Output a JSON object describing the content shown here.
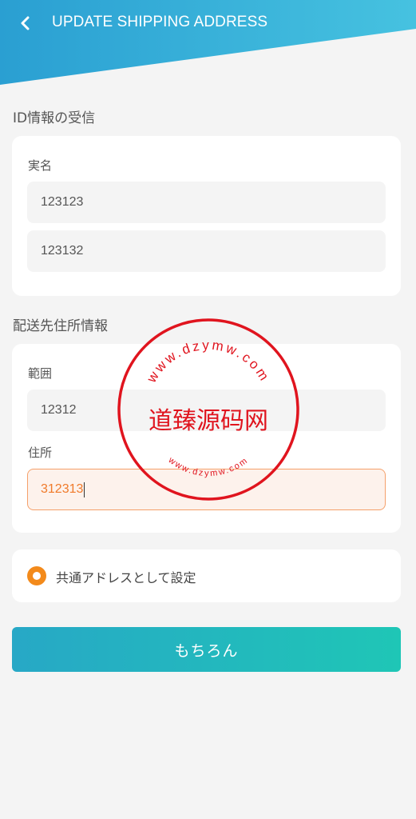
{
  "header": {
    "title": "UPDATE SHIPPING ADDRESS",
    "back_icon": "chevron-left-icon",
    "gradient_start": "#2a9fd2",
    "gradient_end": "#46c2e0"
  },
  "id_section": {
    "title": "ID情報の受信",
    "real_name_label": "実名",
    "fields": [
      {
        "value": "123123"
      },
      {
        "value": "123132"
      }
    ]
  },
  "address_section": {
    "title": "配送先住所情報",
    "region_label": "範囲",
    "region_value": "12312",
    "address_label": "住所",
    "address_value": "312313"
  },
  "default_option": {
    "label": "共通アドレスとして設定",
    "checked": true,
    "accent": "#f38a1b"
  },
  "submit": {
    "label": "もちろん"
  },
  "watermark": {
    "center_text": "道臻源码网",
    "top_arc": "www.dzymw.com",
    "bottom_arc": "www.dzymw.com",
    "color": "#e0141e"
  }
}
